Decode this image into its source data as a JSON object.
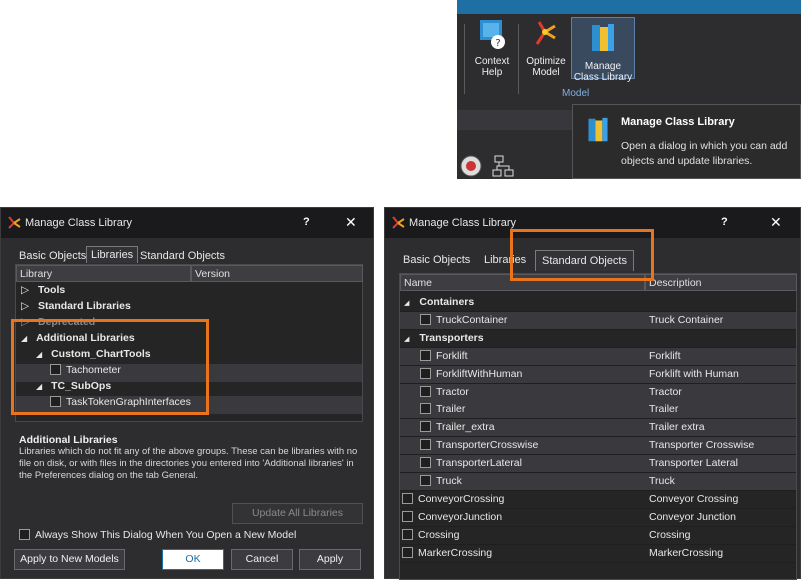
{
  "ribbon": {
    "buttons": [
      {
        "label_line1": "Context",
        "label_line2": "Help"
      },
      {
        "label_line1": "Optimize",
        "label_line2": "Model"
      },
      {
        "label_line1": "Manage",
        "label_line2": "Class Library"
      }
    ],
    "group_label": "Model",
    "tooltip": {
      "title": "Manage Class Library",
      "description": "Open a dialog in which you can add objects and update libraries."
    }
  },
  "left_dialog": {
    "title": "Manage Class Library",
    "help": "?",
    "close": "✕",
    "tabs": [
      "Basic Objects",
      "Libraries",
      "Standard Objects"
    ],
    "active_tab": "Libraries",
    "columns": [
      "Library",
      "Version"
    ],
    "tree": [
      {
        "label": "Tools",
        "expander": "▷"
      },
      {
        "label": "Standard Libraries",
        "expander": "▷"
      },
      {
        "label": "Deprecated",
        "expander": "▷"
      },
      {
        "label": "Additional Libraries",
        "expander": "◢"
      },
      {
        "label": "Custom_ChartTools",
        "expander": "◢"
      },
      {
        "label": "Tachometer"
      },
      {
        "label": "TC_SubOps",
        "expander": "◢"
      },
      {
        "label": "TaskTokenGraphInterfaces"
      }
    ],
    "description_title": "Additional Libraries",
    "description_text": "Libraries which do not fit any of the above groups. These can be libraries with no file on disk, or with files in the directories you entered into 'Additional libraries' in the Preferences dialog on the tab General.",
    "update_button": "Update All Libraries",
    "always_show_label": "Always Show This Dialog When You Open a New Model",
    "apply_new_models": "Apply to New Models",
    "ok": "OK",
    "cancel": "Cancel",
    "apply": "Apply"
  },
  "right_dialog": {
    "title": "Manage Class Library",
    "help": "?",
    "close": "✕",
    "tabs": [
      "Basic Objects",
      "Libraries",
      "Standard Objects"
    ],
    "active_tab": "Standard Objects",
    "columns": [
      "Name",
      "Description"
    ],
    "rows": [
      {
        "name": "Containers",
        "desc": "",
        "type": "group"
      },
      {
        "name": "TruckContainer",
        "desc": "Truck Container",
        "type": "item"
      },
      {
        "name": "Transporters",
        "desc": "",
        "type": "group"
      },
      {
        "name": "Forklift",
        "desc": "Forklift",
        "type": "item"
      },
      {
        "name": "ForkliftWithHuman",
        "desc": "Forklift with Human",
        "type": "item"
      },
      {
        "name": "Tractor",
        "desc": "Tractor",
        "type": "item"
      },
      {
        "name": "Trailer",
        "desc": "Trailer",
        "type": "item"
      },
      {
        "name": "Trailer_extra",
        "desc": "Trailer extra",
        "type": "item"
      },
      {
        "name": "TransporterCrosswise",
        "desc": "Transporter Crosswise",
        "type": "item"
      },
      {
        "name": "TransporterLateral",
        "desc": "Transporter Lateral",
        "type": "item"
      },
      {
        "name": "Truck",
        "desc": "Truck",
        "type": "item"
      },
      {
        "name": "ConveyorCrossing",
        "desc": "Conveyor Crossing",
        "type": "top"
      },
      {
        "name": "ConveyorJunction",
        "desc": "Conveyor Junction",
        "type": "top"
      },
      {
        "name": "Crossing",
        "desc": "Crossing",
        "type": "top"
      },
      {
        "name": "MarkerCrossing",
        "desc": "MarkerCrossing",
        "type": "top"
      }
    ]
  },
  "colors": {
    "accent": "#1e6fa3",
    "highlight": "#e8741e"
  }
}
